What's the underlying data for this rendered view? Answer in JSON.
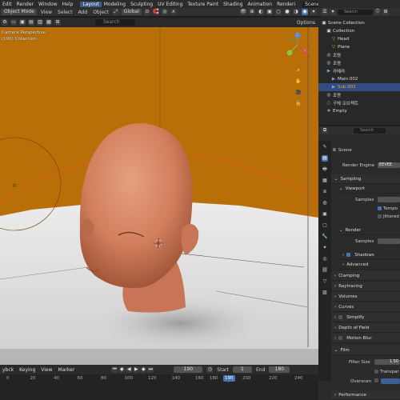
{
  "topbar": {
    "menus": [
      "Edit",
      "Render",
      "Window",
      "Help"
    ],
    "workspaces": [
      "Layout",
      "Modeling",
      "Sculpting",
      "UV Editing",
      "Texture Paint",
      "Shading",
      "Animation",
      "Renderi"
    ],
    "active_workspace": "Layout",
    "scene_label": "Scene"
  },
  "viewport_header": {
    "mode": "Object Mode",
    "menus": [
      "View",
      "Select",
      "Add",
      "Object"
    ],
    "transform_orientation": "Global",
    "options_label": "Options",
    "search_placeholder": "Search"
  },
  "viewport": {
    "perspective_label": "Camera Perspective",
    "collection_label": "(190) Collection",
    "background_color": "#b86f08",
    "floor_color": "#e8e8e8",
    "gizmo_x": "X",
    "gizmo_y": "Y",
    "gizmo_z": "Z"
  },
  "outliner": {
    "search_placeholder": "Search",
    "rows": [
      {
        "icon": "scene-collection-icon",
        "glyph": "▣",
        "label": "Scene Collection",
        "indent": 0,
        "color": "#ddd",
        "selected": false
      },
      {
        "icon": "collection-icon",
        "glyph": "▣",
        "label": "Collection",
        "indent": 1,
        "color": "#ddd",
        "selected": false
      },
      {
        "icon": "object-icon",
        "glyph": "▽",
        "label": "Head",
        "indent": 2,
        "color": "#ddd",
        "selected": false
      },
      {
        "icon": "object-icon",
        "glyph": "▽",
        "label": "Plane",
        "indent": 2,
        "color": "#ddd",
        "selected": false
      },
      {
        "icon": "light-icon",
        "glyph": "◎",
        "label": "조명",
        "indent": 1,
        "color": "#ddd",
        "selected": false
      },
      {
        "icon": "light-icon",
        "glyph": "◎",
        "label": "조명",
        "indent": 1,
        "color": "#ddd",
        "selected": false
      },
      {
        "icon": "camera-icon",
        "glyph": "▶",
        "label": "카메라",
        "indent": 1,
        "color": "#ddd",
        "selected": false
      },
      {
        "icon": "camera-icon",
        "glyph": "▶",
        "label": "Main.002",
        "indent": 2,
        "color": "#ddd",
        "selected": false
      },
      {
        "icon": "camera-icon",
        "glyph": "▶",
        "label": "Sub.001",
        "indent": 2,
        "color": "#f0a030",
        "selected": true
      },
      {
        "icon": "light-icon",
        "glyph": "◎",
        "label": "조명",
        "indent": 1,
        "color": "#ddd",
        "selected": false
      },
      {
        "icon": "object-icon",
        "glyph": "○",
        "label": "구체 오브젝트",
        "indent": 1,
        "color": "#ddd",
        "selected": false
      },
      {
        "icon": "empty-icon",
        "glyph": "✛",
        "label": "Empty",
        "indent": 1,
        "color": "#ddd",
        "selected": false
      }
    ]
  },
  "properties": {
    "search_placeholder": "Search",
    "breadcrumb": "Scene",
    "render_engine_label": "Render Engine",
    "render_engine_value": "EEVEE",
    "sections": {
      "sampling": "Sampling",
      "viewport": "Viewport",
      "samples": "Samples",
      "temporal": "Tempo",
      "jittered": "Jittered",
      "render": "Render",
      "render_samples": "Samples",
      "shadows": "Shadows",
      "advanced": "Advanced",
      "clamping": "Clamping",
      "raytracing": "Raytracing",
      "volumes": "Volumes",
      "curves": "Curves",
      "simplify": "Simplify",
      "dof": "Depth of Field",
      "motion_blur": "Motion Blur",
      "film": "Film",
      "filter_size_label": "Filter Size",
      "filter_size_value": "1.50",
      "transparent": "Transpar",
      "overscan": "Overscan",
      "performance": "Performance"
    },
    "tabs": [
      "tool",
      "render",
      "output",
      "view-layer",
      "scene",
      "world",
      "collection",
      "object",
      "modifier",
      "particles",
      "physics",
      "constraints",
      "data",
      "texture"
    ]
  },
  "timeline": {
    "menus": [
      "ybck",
      "Keying",
      "View",
      "Marker"
    ],
    "current_frame": "190",
    "start_label": "Start",
    "start_value": "1",
    "end_label": "End",
    "end_value": "180",
    "ticks": [
      "0",
      "20",
      "40",
      "60",
      "80",
      "100",
      "120",
      "140",
      "160",
      "180",
      "190",
      "200",
      "220",
      "240"
    ]
  }
}
